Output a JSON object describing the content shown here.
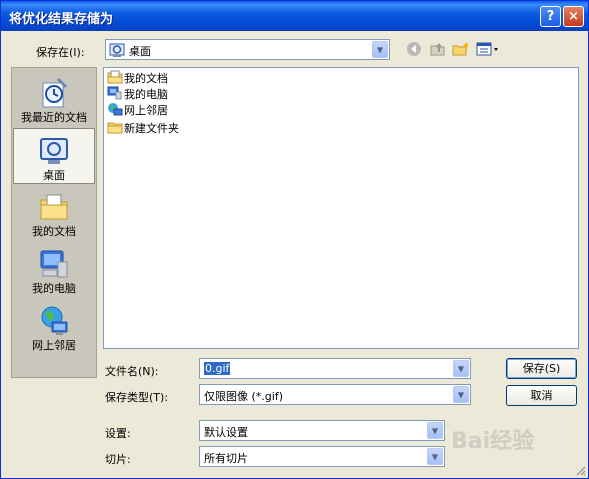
{
  "window": {
    "title": "将优化结果存储为",
    "help_label": "?",
    "close_label": "×"
  },
  "save_in": {
    "label": "保存在(I):",
    "value": "桌面"
  },
  "places": [
    {
      "label": "我最近的文档",
      "icon": "recent-documents-icon"
    },
    {
      "label": "桌面",
      "icon": "desktop-icon",
      "selected": true
    },
    {
      "label": "我的文档",
      "icon": "my-documents-icon"
    },
    {
      "label": "我的电脑",
      "icon": "my-computer-icon"
    },
    {
      "label": "网上邻居",
      "icon": "network-places-icon"
    }
  ],
  "files": [
    {
      "name": "我的文档",
      "icon": "my-documents-icon"
    },
    {
      "name": "我的电脑",
      "icon": "my-computer-icon"
    },
    {
      "name": "网上邻居",
      "icon": "network-places-icon"
    },
    {
      "name": "新建文件夹",
      "icon": "folder-icon"
    }
  ],
  "filename": {
    "label": "文件名(N):",
    "value": "0.gif"
  },
  "filetype": {
    "label": "保存类型(T):",
    "value": "仅限图像 (*.gif)"
  },
  "settings": {
    "label": "设置:",
    "value": "默认设置"
  },
  "slices": {
    "label": "切片:",
    "value": "所有切片"
  },
  "buttons": {
    "save": "保存(S)",
    "cancel": "取消"
  },
  "watermark": "Bai经验",
  "colors": {
    "titlebar": "#0a5ae3",
    "selection": "#316ac5",
    "dialog_bg": "#ece9d8"
  }
}
